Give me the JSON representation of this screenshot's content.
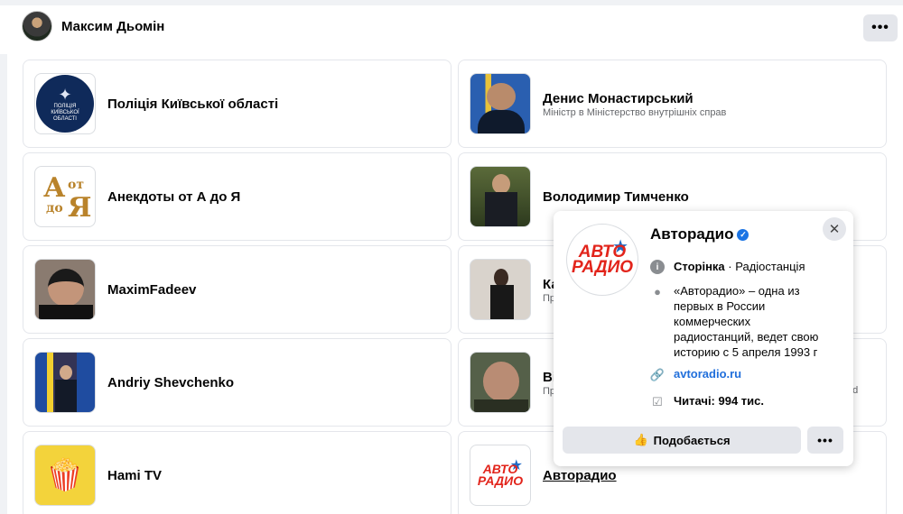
{
  "header": {
    "profile_name": "Максим Дьомін",
    "more_label": "•••"
  },
  "cards": [
    {
      "title": "Поліція Київської області",
      "thumb_text_1": "ПОЛІЦІЯ",
      "thumb_text_2": "КИЇВСЬКОЇ",
      "thumb_text_3": "ОБЛАСТІ"
    },
    {
      "title": "Денис Монастирський",
      "subtitle": "Міністр в Міністерство внутрішніх справ"
    },
    {
      "title": "Анекдоты от А до Я",
      "thumb_a": "А",
      "thumb_ot": "от",
      "thumb_do": "до",
      "thumb_ya": "Я"
    },
    {
      "title": "Володимир Тимченко"
    },
    {
      "title": "MaximFadeev"
    },
    {
      "title": "Ка",
      "subtitle": "Пр"
    },
    {
      "title": "Andriy Shevchenko"
    },
    {
      "title": "Ві",
      "subtitle": "Пр",
      "trailing": "ed"
    },
    {
      "title": "Hami TV"
    },
    {
      "title": "Авторадио",
      "logo_1": "АВТО",
      "logo_2": "РАДИО"
    }
  ],
  "popup": {
    "title": "Авторадио",
    "logo_1": "АВТО",
    "logo_2": "РАДИО",
    "category_bold": "Сторінка",
    "category_rest": " · Радіостанція",
    "description": "«Авторадио» – одна из первых в России коммерческих радиостанций, ведет свою историю с 5 апреля 1993 г",
    "website": "avtoradio.ru",
    "followers": "Читачі: 994 тис.",
    "like_button": "Подобається",
    "more_label": "•••",
    "close_label": "✕"
  },
  "icons": {
    "info": "info-icon",
    "person": "person-icon",
    "link": "link-icon",
    "followers": "followers-icon",
    "like": "thumbs-up-icon",
    "verified": "verified-badge-icon"
  },
  "colors": {
    "accent_blue": "#216fdb",
    "verified_blue": "#1b74e4",
    "logo_red": "#e2241b",
    "button_gray": "#e4e6eb"
  }
}
